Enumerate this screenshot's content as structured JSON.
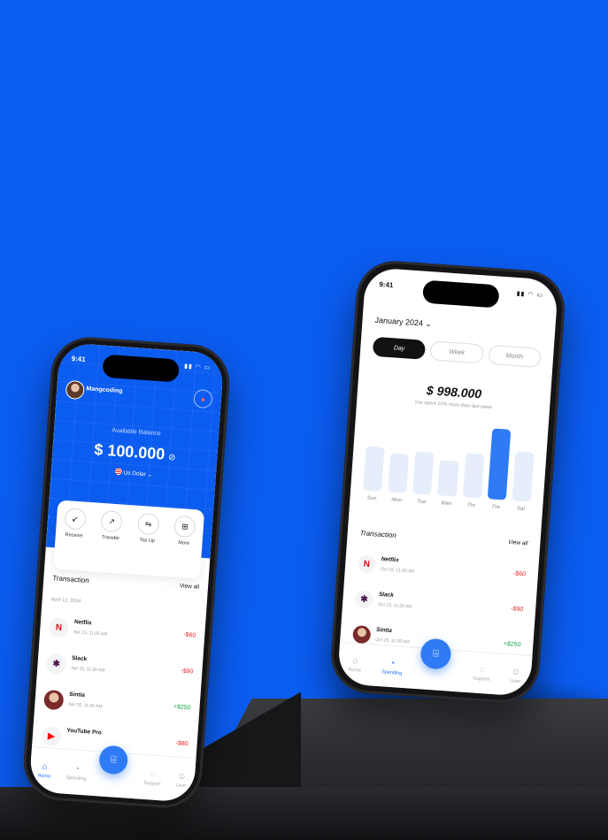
{
  "colors": {
    "background": "#0b5cf0",
    "accent": "#2f7bf5",
    "negative": "#e02424",
    "positive": "#16a34a"
  },
  "left_phone": {
    "time": "9:41",
    "user_name": "Mangcoding",
    "balance_label": "Available Balance",
    "balance": "$ 100.000",
    "currency": "Us Dolar",
    "actions": [
      {
        "label": "Receive",
        "icon": "arrow-down-left-icon"
      },
      {
        "label": "Transfer",
        "icon": "arrow-up-right-icon"
      },
      {
        "label": "Top Up",
        "icon": "swap-icon"
      },
      {
        "label": "More",
        "icon": "grid-icon"
      }
    ],
    "section_title": "Transaction",
    "view_all": "View all",
    "date_group": "April 12, 2024",
    "transactions": [
      {
        "name": "Netflix",
        "time": "Apr 15, 11.00 AM",
        "amount": "-$60"
      },
      {
        "name": "Slack",
        "time": "Apr 15, 11.00 AM",
        "amount": "-$90"
      },
      {
        "name": "Sintia",
        "time": "Apr 10, 11.00 AM",
        "amount": "+$250"
      },
      {
        "name": "YouTube Pro",
        "time": "",
        "amount": "-$80"
      }
    ],
    "nav": [
      {
        "label": "Home",
        "icon": "home-icon"
      },
      {
        "label": "Spending",
        "icon": "pie-chart-icon"
      },
      {
        "label": "Support",
        "icon": "chat-icon"
      },
      {
        "label": "User",
        "icon": "user-icon"
      }
    ]
  },
  "right_phone": {
    "time": "9:41",
    "month": "January 2024",
    "segments": [
      "Day",
      "Week",
      "Month"
    ],
    "total": "$ 998.000",
    "subtitle": "You spent 10% more than last week",
    "days": [
      "Sun",
      "Mon",
      "Tue",
      "Wen",
      "Thr",
      "Fre",
      "Sat"
    ],
    "bar_values": [
      0.62,
      0.55,
      0.6,
      0.5,
      0.62,
      1.0,
      0.7
    ],
    "section_title": "Transaction",
    "view_all": "View all",
    "transactions": [
      {
        "name": "Netflix",
        "time": "Oct 15, 11.00 AM",
        "amount": "-$60"
      },
      {
        "name": "Slack",
        "time": "Oct 15, 11.00 AM",
        "amount": "-$90"
      },
      {
        "name": "Sintia",
        "time": "Oct 15, 11.00 AM",
        "amount": "+$250"
      }
    ],
    "nav": [
      {
        "label": "Home",
        "icon": "home-icon"
      },
      {
        "label": "Spending",
        "icon": "pie-chart-icon"
      },
      {
        "label": "Support",
        "icon": "chat-icon"
      },
      {
        "label": "User",
        "icon": "user-icon"
      }
    ]
  }
}
